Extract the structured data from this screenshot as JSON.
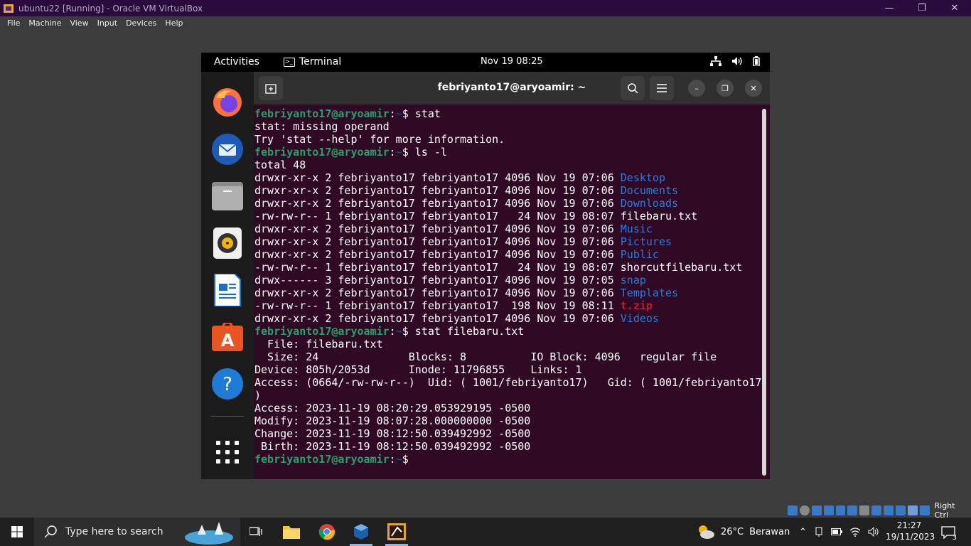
{
  "host_window": {
    "title": "ubuntu22 [Running] - Oracle VM VirtualBox",
    "menu": [
      "File",
      "Machine",
      "View",
      "Input",
      "Devices",
      "Help"
    ],
    "controls": {
      "minimize": "—",
      "restore": "❐",
      "close": "✕"
    }
  },
  "gnome": {
    "activities": "Activities",
    "app_name": "Terminal",
    "clock": "Nov 19  08:25",
    "system_icons": [
      "network-icon",
      "volume-icon",
      "battery-icon"
    ]
  },
  "dock": {
    "apps": [
      "firefox",
      "thunderbird",
      "files",
      "rhythmbox",
      "libreoffice-writer",
      "app-center",
      "help",
      "show-apps"
    ]
  },
  "terminal": {
    "title": "febriyanto17@aryoamir: ~",
    "prompt_user": "febriyanto17@aryoamir",
    "prompt_sep": ":",
    "prompt_path": "~",
    "prompt_end": "$ ",
    "lines": [
      {
        "kind": "prompt",
        "cmd": "stat"
      },
      {
        "kind": "text",
        "text": "stat: missing operand"
      },
      {
        "kind": "text",
        "text": "Try 'stat --help' for more information."
      },
      {
        "kind": "prompt",
        "cmd": "ls -l"
      },
      {
        "kind": "text",
        "text": "total 48"
      },
      {
        "kind": "ls",
        "meta": "drwxr-xr-x 2 febriyanto17 febriyanto17 4096 Nov 19 07:06 ",
        "name": "Desktop",
        "type": "dir"
      },
      {
        "kind": "ls",
        "meta": "drwxr-xr-x 2 febriyanto17 febriyanto17 4096 Nov 19 07:06 ",
        "name": "Documents",
        "type": "dir"
      },
      {
        "kind": "ls",
        "meta": "drwxr-xr-x 2 febriyanto17 febriyanto17 4096 Nov 19 07:06 ",
        "name": "Downloads",
        "type": "dir"
      },
      {
        "kind": "ls",
        "meta": "-rw-rw-r-- 1 febriyanto17 febriyanto17   24 Nov 19 08:07 ",
        "name": "filebaru.txt",
        "type": "file"
      },
      {
        "kind": "ls",
        "meta": "drwxr-xr-x 2 febriyanto17 febriyanto17 4096 Nov 19 07:06 ",
        "name": "Music",
        "type": "dir"
      },
      {
        "kind": "ls",
        "meta": "drwxr-xr-x 2 febriyanto17 febriyanto17 4096 Nov 19 07:06 ",
        "name": "Pictures",
        "type": "dir"
      },
      {
        "kind": "ls",
        "meta": "drwxr-xr-x 2 febriyanto17 febriyanto17 4096 Nov 19 07:06 ",
        "name": "Public",
        "type": "dir"
      },
      {
        "kind": "ls",
        "meta": "-rw-rw-r-- 1 febriyanto17 febriyanto17   24 Nov 19 08:07 ",
        "name": "shorcutfilebaru.txt",
        "type": "file"
      },
      {
        "kind": "ls",
        "meta": "drwx------ 3 febriyanto17 febriyanto17 4096 Nov 19 07:05 ",
        "name": "snap",
        "type": "dir"
      },
      {
        "kind": "ls",
        "meta": "drwxr-xr-x 2 febriyanto17 febriyanto17 4096 Nov 19 07:06 ",
        "name": "Templates",
        "type": "dir"
      },
      {
        "kind": "ls",
        "meta": "-rw-rw-r-- 1 febriyanto17 febriyanto17  198 Nov 19 08:11 ",
        "name": "t.zip",
        "type": "archive"
      },
      {
        "kind": "ls",
        "meta": "drwxr-xr-x 2 febriyanto17 febriyanto17 4096 Nov 19 07:06 ",
        "name": "Videos",
        "type": "dir"
      },
      {
        "kind": "prompt",
        "cmd": "stat filebaru.txt"
      },
      {
        "kind": "text",
        "text": "  File: filebaru.txt"
      },
      {
        "kind": "text",
        "text": "  Size: 24              Blocks: 8          IO Block: 4096   regular file"
      },
      {
        "kind": "text",
        "text": "Device: 805h/2053d      Inode: 11796855    Links: 1"
      },
      {
        "kind": "text",
        "text": "Access: (0664/-rw-rw-r--)  Uid: ( 1001/febriyanto17)   Gid: ( 1001/febriyanto17"
      },
      {
        "kind": "text",
        "text": ")"
      },
      {
        "kind": "text",
        "text": "Access: 2023-11-19 08:20:29.053929195 -0500"
      },
      {
        "kind": "text",
        "text": "Modify: 2023-11-19 08:07:28.000000000 -0500"
      },
      {
        "kind": "text",
        "text": "Change: 2023-11-19 08:12:50.039492992 -0500"
      },
      {
        "kind": "text",
        "text": " Birth: 2023-11-19 08:12:50.039492992 -0500"
      },
      {
        "kind": "prompt",
        "cmd": ""
      }
    ]
  },
  "vb_status": {
    "host_key": "Right Ctrl"
  },
  "taskbar": {
    "search_placeholder": "Type here to search",
    "weather": {
      "temp": "26°C",
      "condition": "Berawan"
    },
    "time": "21:27",
    "date": "19/11/2023",
    "notification_count": "3"
  },
  "colors": {
    "terminal_bg": "#300a24",
    "prompt_user": "#26a269",
    "prompt_path": "#12488b",
    "directory": "#2a7bde",
    "archive": "#c01c28",
    "host_titlebar": "#2b0a3d"
  }
}
